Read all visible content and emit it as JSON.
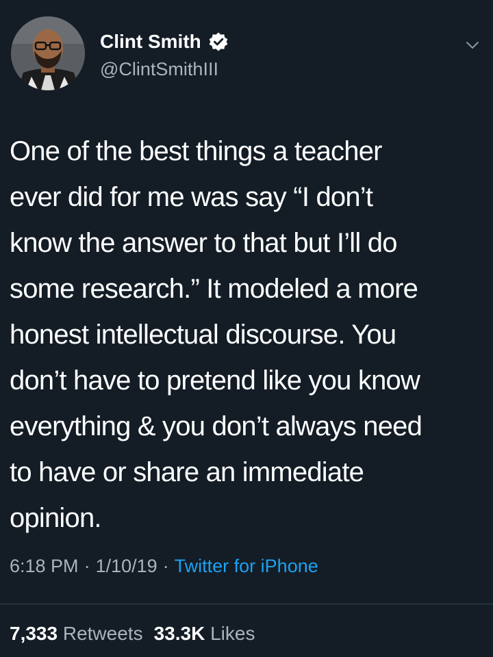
{
  "author": {
    "display_name": "Clint Smith",
    "handle": "@ClintSmithIII",
    "verified": true,
    "avatar_icon": "profile-photo",
    "verified_icon": "verified-badge-icon"
  },
  "menu_icon": "chevron-down-icon",
  "tweet": {
    "text": "One of the best things a teacher\never did for me was say “I don’t\nknow the answer to that but I’ll do\nsome research.” It modeled a more\nhonest intellectual discourse. You\ndon’t have to pretend like you know\neverything & you don’t always need\nto have or share an immediate\nopinion."
  },
  "meta": {
    "time": "6:18 PM",
    "separator": "·",
    "date": "1/10/19",
    "source": "Twitter for iPhone"
  },
  "stats": {
    "retweets_count": "7,333",
    "retweets_label": "Retweets",
    "likes_count": "33.3K",
    "likes_label": "Likes"
  },
  "colors": {
    "background": "#141d26",
    "text": "#ffffff",
    "secondary_text": "#a9b4bf",
    "link": "#1da1f2",
    "divider": "#38444d"
  }
}
